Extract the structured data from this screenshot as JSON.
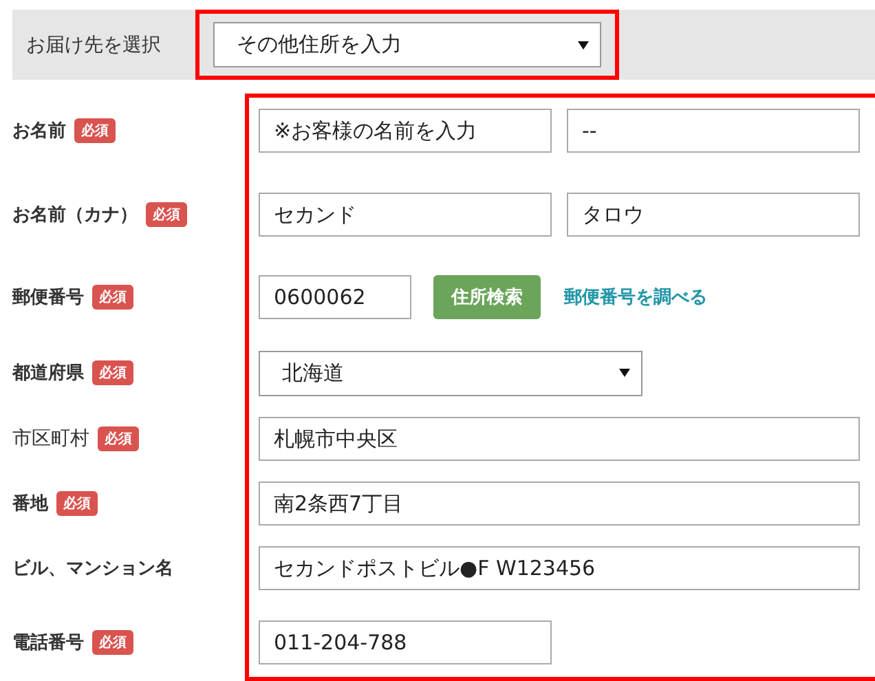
{
  "destination": {
    "label": "お届け先を選択",
    "select": {
      "value": "その他住所を入力"
    }
  },
  "rows": [
    {
      "label": "お名前",
      "bold": true,
      "required": "必須",
      "controls": [
        {
          "kind": "input",
          "value": "※お客様の名前を入力"
        },
        {
          "kind": "input",
          "value": "--"
        }
      ]
    },
    {
      "label": "お名前（カナ）",
      "bold": true,
      "required": "必須",
      "controls": [
        {
          "kind": "input",
          "value": "セカンド"
        },
        {
          "kind": "input",
          "value": "タロウ"
        }
      ]
    },
    {
      "label": "郵便番号",
      "bold": true,
      "required": "必須",
      "controls": [
        {
          "kind": "input",
          "value": "0600062"
        },
        {
          "kind": "button",
          "label": "住所検索"
        },
        {
          "kind": "link",
          "label": "郵便番号を調べる"
        }
      ]
    },
    {
      "label": "都道府県",
      "bold": true,
      "required": "必須",
      "controls": [
        {
          "kind": "select",
          "value": "北海道"
        }
      ]
    },
    {
      "label": "市区町村",
      "bold": false,
      "required": "必須",
      "controls": [
        {
          "kind": "input",
          "value": "札幌市中央区"
        }
      ]
    },
    {
      "label": "番地",
      "bold": true,
      "required": "必須",
      "controls": [
        {
          "kind": "input",
          "value": "南2条西7丁目"
        }
      ]
    },
    {
      "label": "ビル、マンション名",
      "bold": true,
      "controls": [
        {
          "kind": "input",
          "value": "セカンドポストビル●F W123456"
        }
      ]
    },
    {
      "label": "電話番号",
      "bold": true,
      "required": "必須",
      "controls": [
        {
          "kind": "input",
          "value": "011-204-788"
        }
      ]
    }
  ]
}
